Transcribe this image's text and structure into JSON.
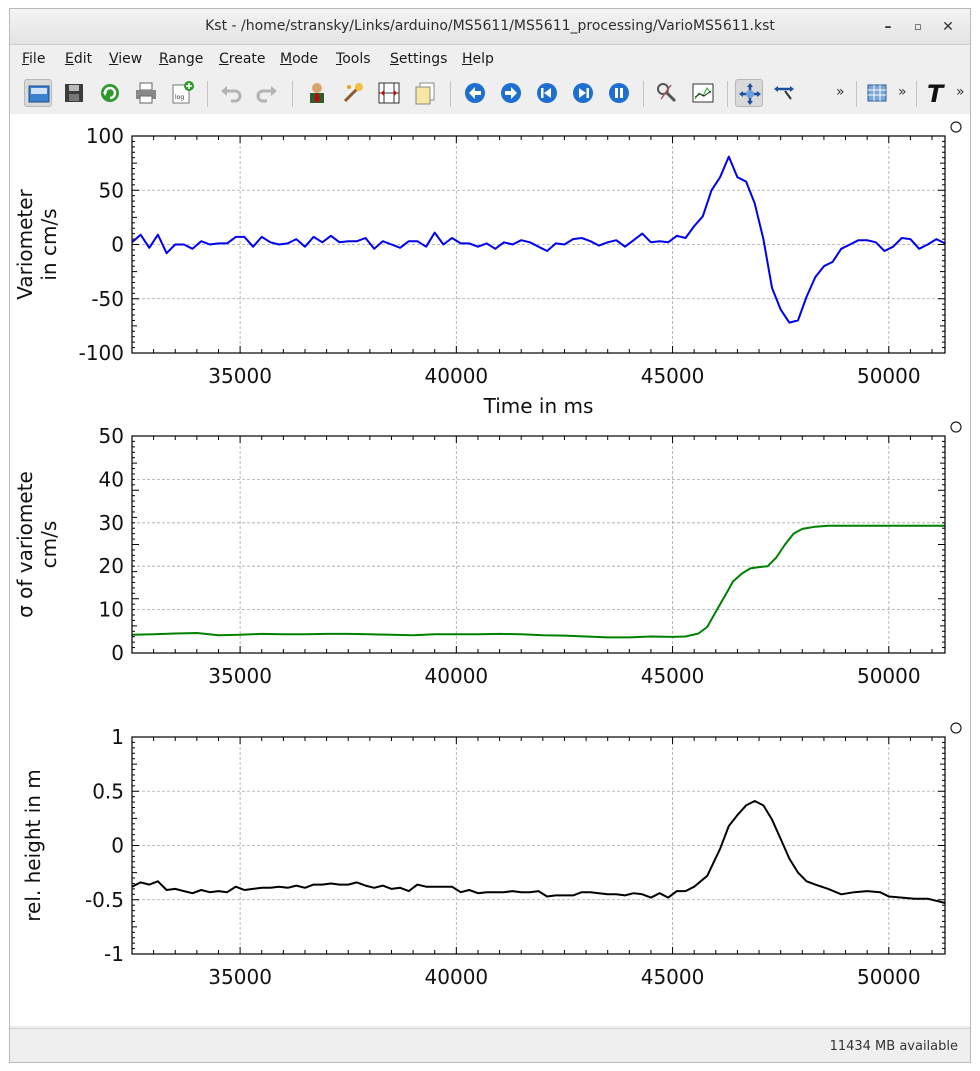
{
  "window": {
    "title": "Kst - /home/stransky/Links/arduino/MS5611/MS5611_processing/VarioMS5611.kst",
    "controls": [
      "minimize-icon",
      "maximize-icon",
      "close-icon"
    ]
  },
  "menu": [
    {
      "label": "File",
      "key": "F",
      "rest": "ile"
    },
    {
      "label": "Edit",
      "key": "E",
      "rest": "dit"
    },
    {
      "label": "View",
      "key": "V",
      "rest": "iew"
    },
    {
      "label": "Range",
      "key": "R",
      "rest": "ange"
    },
    {
      "label": "Create",
      "key": "C",
      "rest": "reate"
    },
    {
      "label": "Mode",
      "key": "M",
      "rest": "ode"
    },
    {
      "label": "Tools",
      "key": "T",
      "rest": "ools"
    },
    {
      "label": "Settings",
      "key": "S",
      "rest": "ettings"
    },
    {
      "label": "Help",
      "key": "H",
      "rest": "elp"
    }
  ],
  "toolbar": {
    "icons": [
      "open-icon",
      "save-icon",
      "reload-icon",
      "print-icon",
      "export-log-icon",
      "undo-icon",
      "redo-icon",
      "data-manager-icon",
      "data-wizard-icon",
      "change-data-sample-icon",
      "change-data-file-icon",
      "back-icon",
      "forward-icon",
      "read-from-end-icon",
      "pause-icon",
      "zoom-mode-icon",
      "layout-mode-icon",
      "tied-zoom-icon",
      "zoom-x-icon",
      "table-icon",
      "text-icon"
    ],
    "overflow": "»"
  },
  "status": {
    "memory": "11434 MB available"
  },
  "colors": {
    "series1": "#0000ee",
    "series2": "#008000",
    "series3": "#000000"
  },
  "chart_data": [
    {
      "type": "line",
      "ylabel": "Variometer\nin cm/s",
      "xlabel": "Time in ms",
      "xlim": [
        32500,
        51300
      ],
      "ylim": [
        -100,
        100
      ],
      "yticks": [
        "100",
        "50",
        "0",
        "-50",
        "-100"
      ],
      "xticks": [
        "35000",
        "40000",
        "45000",
        "50000"
      ],
      "series": [
        {
          "color": "#0000ee",
          "x": [
            32500,
            32700,
            32900,
            33100,
            33300,
            33500,
            33700,
            33900,
            34100,
            34300,
            34500,
            34700,
            34900,
            35100,
            35300,
            35500,
            35700,
            35900,
            36100,
            36300,
            36500,
            36700,
            36900,
            37100,
            37300,
            37500,
            37700,
            37900,
            38100,
            38300,
            38500,
            38700,
            38900,
            39100,
            39300,
            39500,
            39700,
            39900,
            40100,
            40300,
            40500,
            40700,
            40900,
            41100,
            41300,
            41500,
            41700,
            41900,
            42100,
            42300,
            42500,
            42700,
            42900,
            43100,
            43300,
            43500,
            43700,
            43900,
            44100,
            44300,
            44500,
            44700,
            44900,
            45100,
            45300,
            45500,
            45700,
            45900,
            46100,
            46300,
            46500,
            46700,
            46900,
            47100,
            47300,
            47500,
            47700,
            47900,
            48100,
            48300,
            48500,
            48700,
            48900,
            49100,
            49300,
            49500,
            49700,
            49900,
            50100,
            50300,
            50500,
            50700,
            50900,
            51100,
            51300
          ],
          "y": [
            2,
            9,
            -3,
            9,
            -8,
            0,
            0,
            -4,
            3,
            0,
            1,
            1,
            7,
            7,
            -2,
            7,
            2,
            0,
            1,
            5,
            -2,
            7,
            2,
            8,
            2,
            3,
            3,
            6,
            -4,
            3,
            0,
            -3,
            3,
            3,
            -2,
            11,
            0,
            6,
            1,
            1,
            -2,
            1,
            -4,
            2,
            0,
            4,
            2,
            -2,
            -6,
            1,
            0,
            5,
            6,
            3,
            -1,
            2,
            4,
            -2,
            4,
            10,
            2,
            3,
            2,
            8,
            6,
            17,
            26,
            50,
            62,
            81,
            62,
            58,
            38,
            5,
            -40,
            -60,
            -72,
            -70,
            -48,
            -30,
            -20,
            -16,
            -4,
            0,
            4,
            4,
            2,
            -6,
            -2,
            6,
            5,
            -4,
            0,
            5,
            1
          ]
        }
      ]
    },
    {
      "type": "line",
      "ylabel": "σ of variomete\ncm/s",
      "xlabel": "",
      "xlim": [
        32500,
        51300
      ],
      "ylim": [
        0,
        50
      ],
      "yticks": [
        "50",
        "40",
        "30",
        "20",
        "10",
        "0"
      ],
      "xticks": [
        "35000",
        "40000",
        "45000",
        "50000"
      ],
      "series": [
        {
          "color": "#008000",
          "x": [
            32500,
            33000,
            33500,
            34000,
            34500,
            35000,
            35500,
            36000,
            36500,
            37000,
            37500,
            38000,
            38500,
            39000,
            39500,
            40000,
            40500,
            41000,
            41500,
            42000,
            42500,
            43000,
            43500,
            44000,
            44500,
            45000,
            45300,
            45600,
            45800,
            46000,
            46200,
            46400,
            46600,
            46800,
            47000,
            47200,
            47400,
            47600,
            47800,
            48000,
            48300,
            48600,
            49000,
            49500,
            50000,
            50500,
            51000,
            51300
          ],
          "y": [
            4.2,
            4.3,
            4.5,
            4.6,
            4.1,
            4.2,
            4.4,
            4.3,
            4.3,
            4.4,
            4.4,
            4.3,
            4.2,
            4.1,
            4.3,
            4.3,
            4.3,
            4.4,
            4.3,
            4.1,
            4.0,
            3.8,
            3.6,
            3.6,
            3.8,
            3.7,
            3.8,
            4.5,
            6,
            9.5,
            13,
            16.5,
            18.3,
            19.5,
            19.8,
            20,
            22,
            25,
            27.5,
            28.6,
            29.1,
            29.3,
            29.3,
            29.3,
            29.3,
            29.3,
            29.3,
            29.3
          ]
        }
      ]
    },
    {
      "type": "line",
      "ylabel": "rel. height in m",
      "xlabel": "",
      "xlim": [
        32500,
        51300
      ],
      "ylim": [
        -1,
        1
      ],
      "yticks": [
        "1",
        "0.5",
        "0",
        "-0.5",
        "-1"
      ],
      "xticks": [
        "35000",
        "40000",
        "45000",
        "50000"
      ],
      "series": [
        {
          "color": "#000000",
          "x": [
            32500,
            32700,
            32900,
            33100,
            33300,
            33500,
            33700,
            33900,
            34100,
            34300,
            34500,
            34700,
            34900,
            35100,
            35300,
            35500,
            35700,
            35900,
            36100,
            36300,
            36500,
            36700,
            36900,
            37100,
            37300,
            37500,
            37700,
            37900,
            38100,
            38300,
            38500,
            38700,
            38900,
            39100,
            39300,
            39500,
            39700,
            39900,
            40100,
            40300,
            40500,
            40700,
            40900,
            41100,
            41300,
            41500,
            41700,
            41900,
            42100,
            42300,
            42500,
            42700,
            42900,
            43100,
            43300,
            43500,
            43700,
            43900,
            44100,
            44300,
            44500,
            44700,
            44900,
            45100,
            45300,
            45500,
            45800,
            46100,
            46300,
            46500,
            46700,
            46900,
            47100,
            47300,
            47500,
            47700,
            47900,
            48100,
            48300,
            48600,
            48900,
            49200,
            49500,
            49800,
            50000,
            50300,
            50600,
            50900,
            51100,
            51300
          ],
          "y": [
            -0.38,
            -0.34,
            -0.36,
            -0.33,
            -0.41,
            -0.4,
            -0.42,
            -0.44,
            -0.41,
            -0.43,
            -0.42,
            -0.43,
            -0.38,
            -0.41,
            -0.4,
            -0.39,
            -0.39,
            -0.38,
            -0.39,
            -0.37,
            -0.39,
            -0.36,
            -0.36,
            -0.35,
            -0.36,
            -0.36,
            -0.34,
            -0.37,
            -0.39,
            -0.37,
            -0.4,
            -0.39,
            -0.42,
            -0.36,
            -0.38,
            -0.38,
            -0.38,
            -0.38,
            -0.43,
            -0.41,
            -0.44,
            -0.43,
            -0.43,
            -0.43,
            -0.42,
            -0.43,
            -0.43,
            -0.42,
            -0.47,
            -0.46,
            -0.46,
            -0.46,
            -0.43,
            -0.43,
            -0.44,
            -0.45,
            -0.45,
            -0.46,
            -0.44,
            -0.45,
            -0.48,
            -0.44,
            -0.48,
            -0.42,
            -0.42,
            -0.38,
            -0.28,
            -0.03,
            0.18,
            0.28,
            0.37,
            0.41,
            0.37,
            0.24,
            0.06,
            -0.12,
            -0.25,
            -0.33,
            -0.36,
            -0.4,
            -0.45,
            -0.43,
            -0.42,
            -0.43,
            -0.47,
            -0.48,
            -0.49,
            -0.49,
            -0.51,
            -0.53
          ]
        }
      ]
    }
  ]
}
